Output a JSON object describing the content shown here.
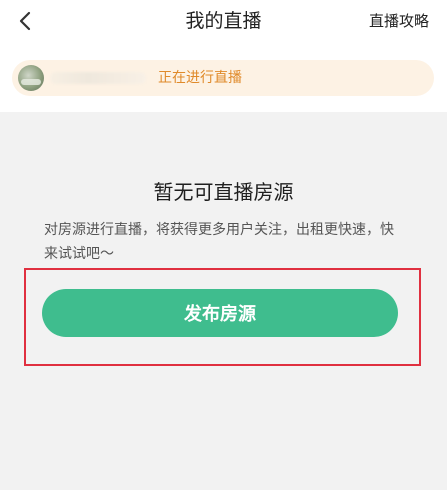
{
  "nav": {
    "title": "我的直播",
    "guide_label": "直播攻略"
  },
  "live_banner": {
    "status_text": "正在进行直播"
  },
  "empty_state": {
    "title": "暂无可直播房源",
    "description": "对房源进行直播，将获得更多用户关注，出租更快速，快来试试吧～",
    "publish_button_label": "发布房源"
  },
  "colors": {
    "accent_green": "#3fbd8e",
    "banner_bg": "#fdf2e4",
    "banner_text": "#e08a2a",
    "highlight_red": "#e03040"
  },
  "icons": {
    "back": "chevron-left-icon"
  }
}
